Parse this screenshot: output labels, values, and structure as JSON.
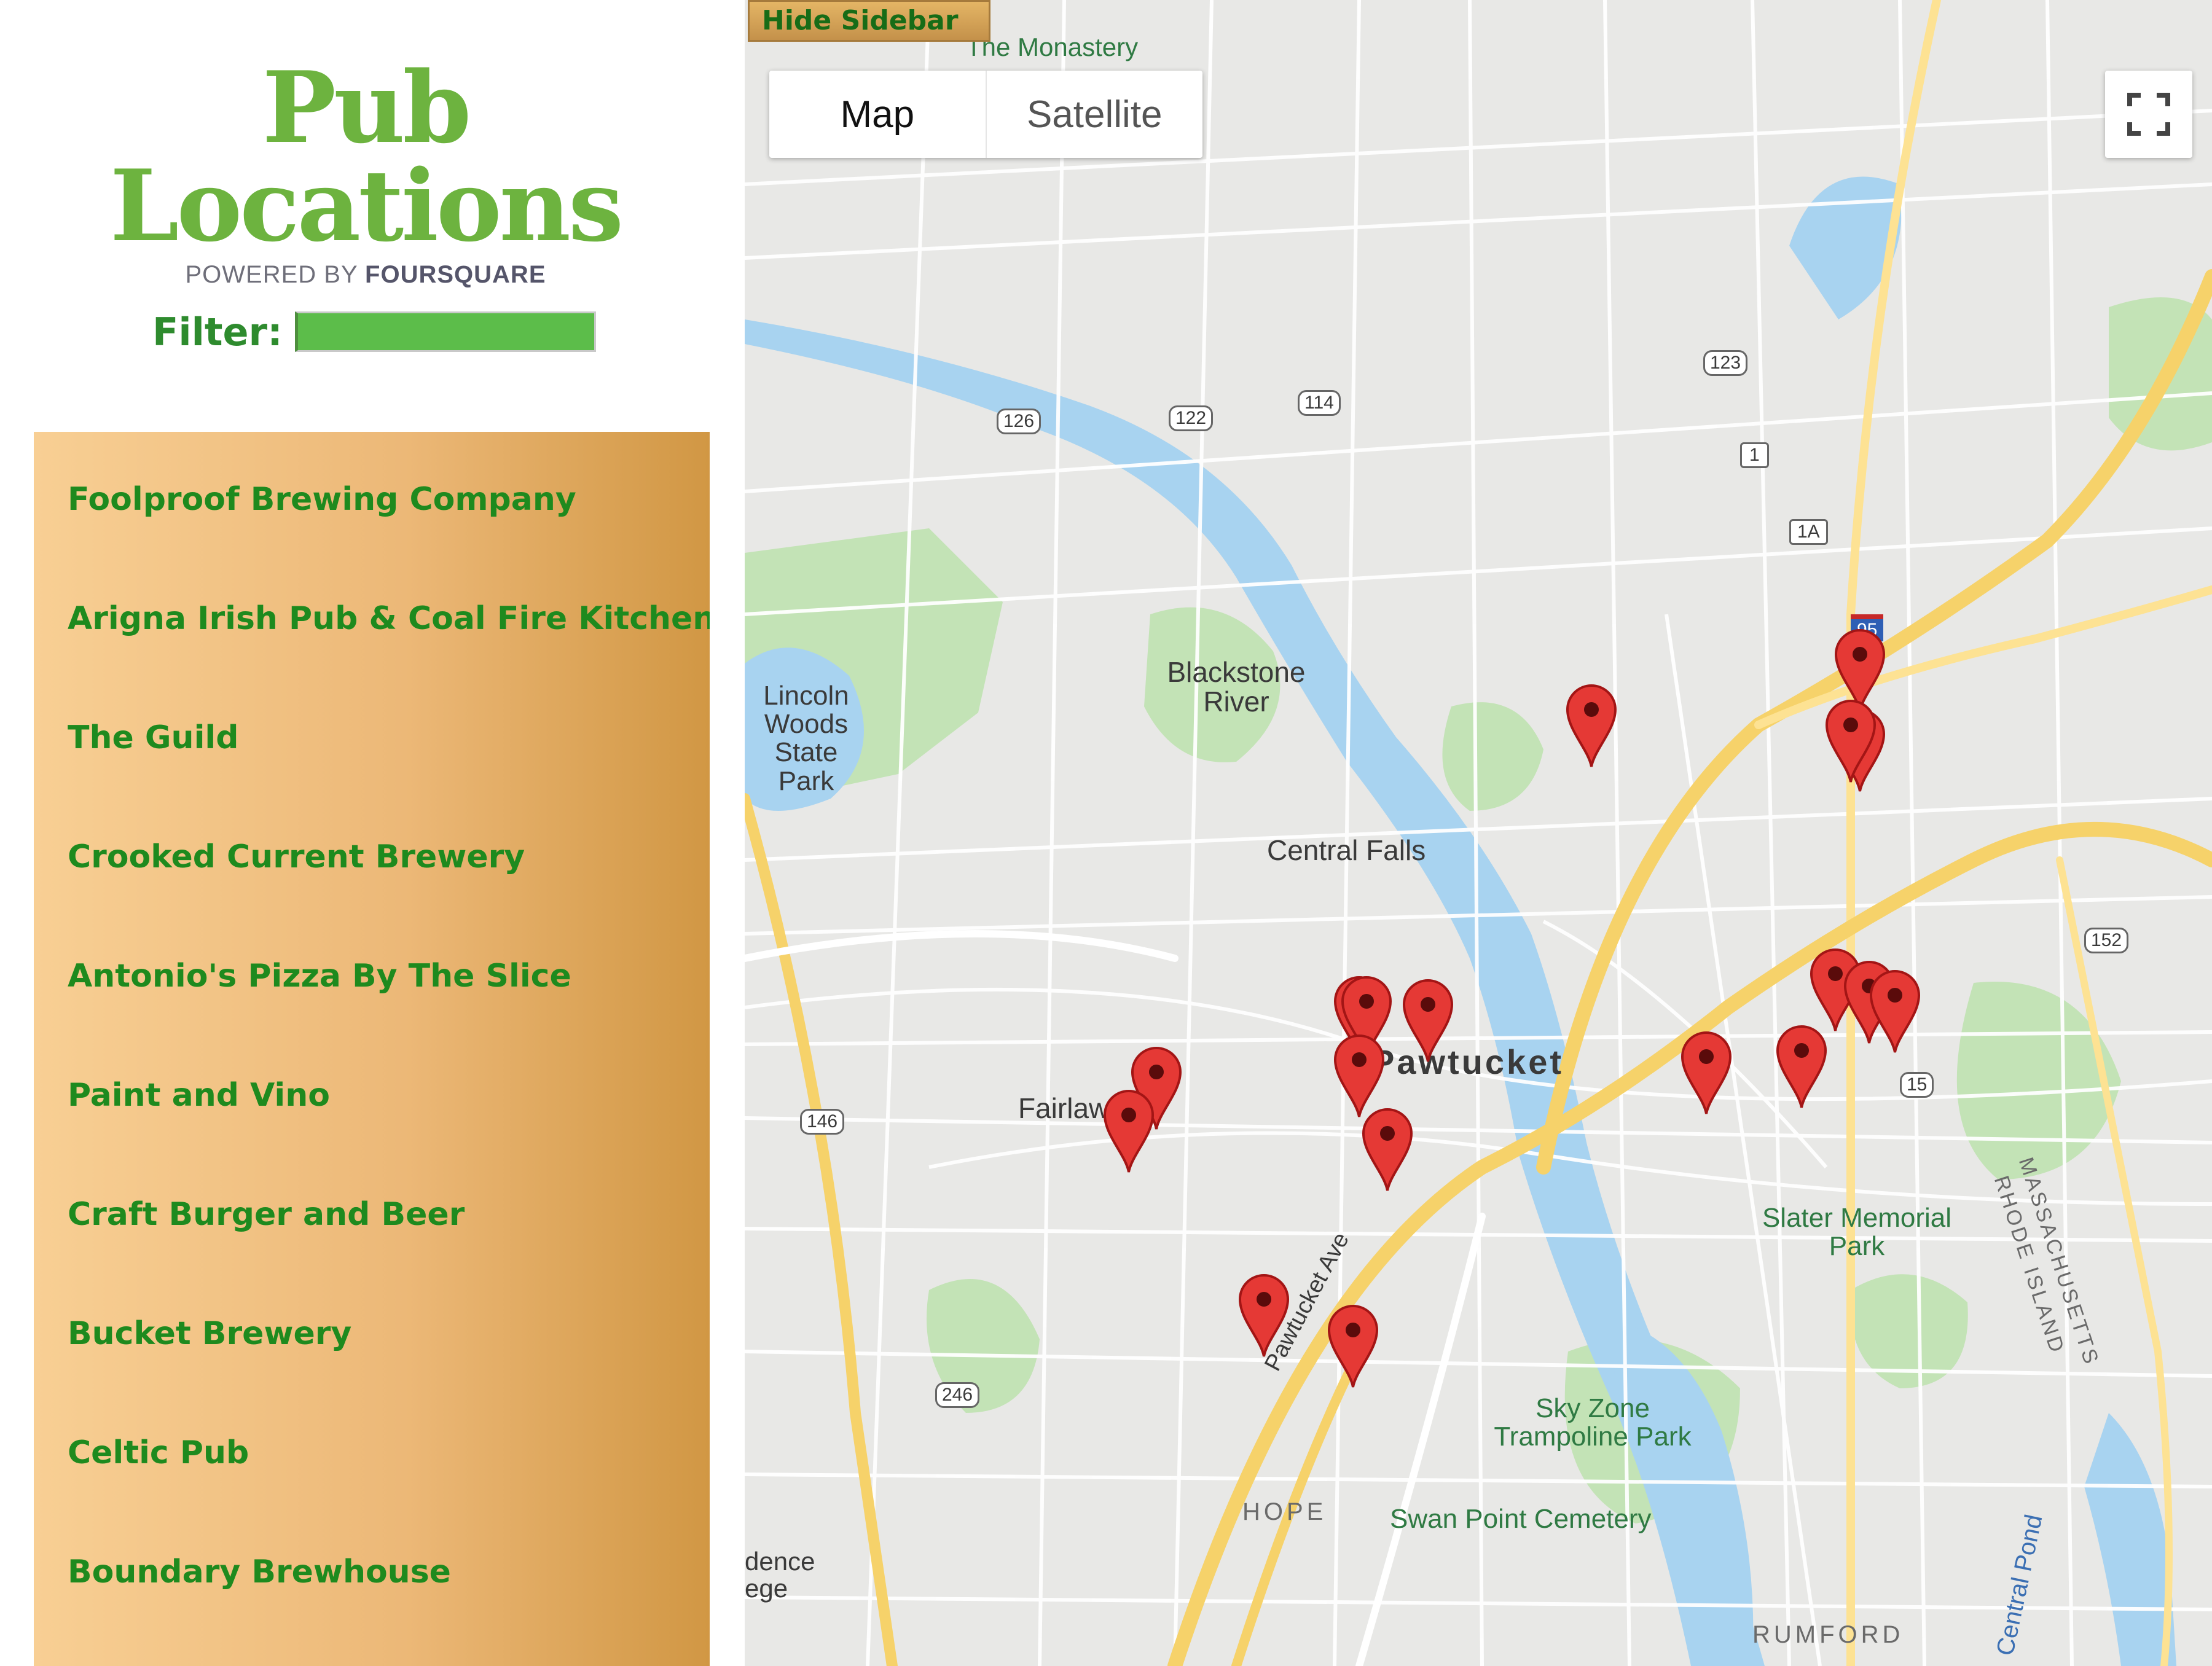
{
  "sidebar": {
    "title": "Pub Locations",
    "powered_by_prefix": "POWERED BY",
    "powered_by_brand": "FOURSQUARE",
    "filter_label": "Filter:",
    "filter_value": "",
    "pubs": [
      "Foolproof Brewing Company",
      "Arigna Irish Pub & Coal Fire Kitchen",
      "The Guild",
      "Crooked Current Brewery",
      "Antonio's Pizza By The Slice",
      "Paint and Vino",
      "Craft Burger and Beer",
      "Bucket Brewery",
      "Celtic Pub",
      "Boundary Brewhouse"
    ]
  },
  "map": {
    "hide_sidebar_label": "Hide Sidebar",
    "map_type_options": [
      "Map",
      "Satellite"
    ],
    "selected_map_type": "Map",
    "fullscreen_icon": "fullscreen-icon",
    "marker_icon": "map-marker-icon",
    "marker_color": "#e53935",
    "labels": {
      "monastery": "The Monastery",
      "lincoln_woods": "Lincoln Woods State Park",
      "blackstone_river": "Blackstone River",
      "central_falls": "Central Falls",
      "pawtucket": "Pawtucket",
      "fairlawn": "Fairlawn",
      "slater_park": "Slater Memorial Park",
      "sky_zone": "Sky Zone Trampoline Park",
      "swan_point": "Swan Point Cemetery",
      "hope": "HOPE",
      "rumford": "RUMFORD",
      "massachusetts": "MASSACHUSETTS",
      "rhode_island": "RHODE ISLAND",
      "pawtucket_ave": "Pawtucket Ave",
      "central_pond": "Central Pond",
      "providence_college": "dence ege"
    },
    "route_shields": [
      "126",
      "122",
      "114",
      "123",
      "1",
      "1A",
      "95",
      "146",
      "246",
      "152",
      "15"
    ]
  }
}
